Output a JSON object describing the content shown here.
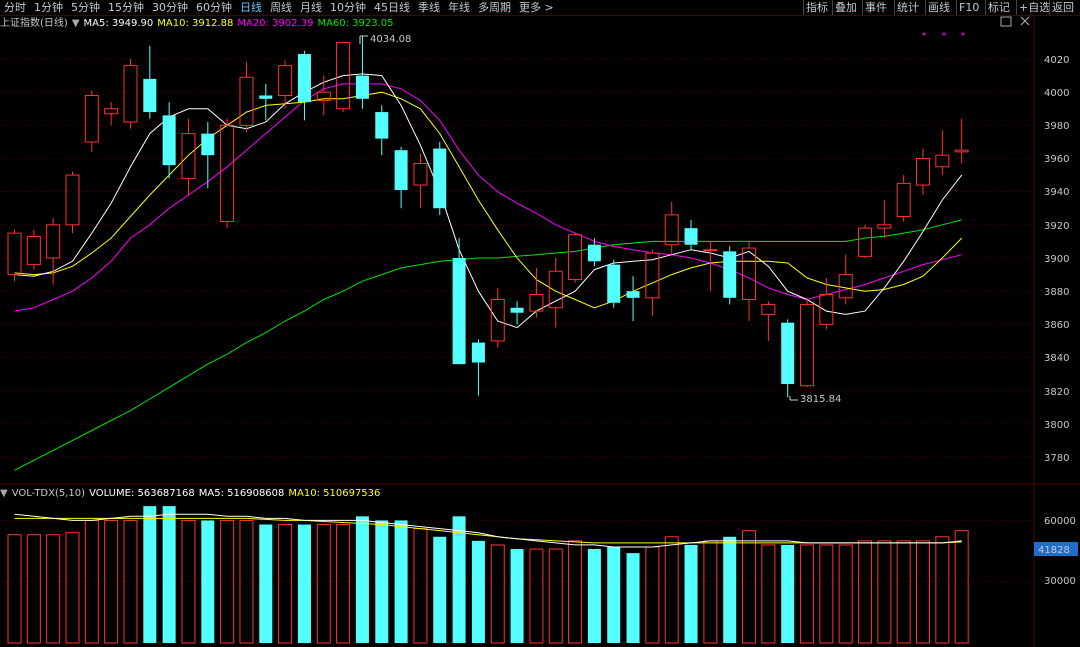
{
  "topbar": {
    "timeframes": [
      "分时",
      "1分钟",
      "5分钟",
      "15分钟",
      "30分钟",
      "60分钟",
      "日线",
      "周线",
      "月线",
      "10分钟",
      "45日线",
      "季线",
      "年线",
      "多周期",
      "更多 >"
    ],
    "active": "日线",
    "tools": [
      "指标",
      "叠加",
      "事件",
      "统计",
      "画线",
      "F10",
      "标记",
      "+自选",
      "返回"
    ]
  },
  "price_legend": {
    "name": "上证指数(日线)",
    "ma5": "MA5: 3949.90",
    "ma10": "MA10: 3912.88",
    "ma20": "MA20: 3902.39",
    "ma60": "MA60: 3923.05"
  },
  "vol_legend": {
    "name": "VOL-TDX(5,10)",
    "volume": "VOLUME: 563687168",
    "ma5": "MA5: 516908608",
    "ma10": "MA10: 510697536"
  },
  "annotations": {
    "high": "4034.08",
    "low": "3815.84"
  },
  "price_axis": {
    "ticks": [
      "4020",
      "4000",
      "3980",
      "3960",
      "3940",
      "3920",
      "3900",
      "3880",
      "3860",
      "3840",
      "3820",
      "3800",
      "3780"
    ]
  },
  "vol_axis": {
    "ticks": [
      "60000",
      "30000"
    ],
    "current": "41828"
  },
  "colors": {
    "up": "#ff3232",
    "down": "#54ffff",
    "ma5": "#ffffff",
    "ma10": "#ffff00",
    "ma20": "#ff00ff",
    "ma60": "#00e600",
    "grid": "#3c0000"
  },
  "chart_data": {
    "type": "candlestick",
    "ylim": [
      3770,
      4035
    ],
    "vol_ylim": [
      0,
      70000
    ],
    "candles": [
      {
        "o": 3890,
        "c": 3915,
        "h": 3917,
        "l": 3886,
        "v": 53000
      },
      {
        "o": 3896,
        "c": 3913,
        "h": 3917,
        "l": 3893,
        "v": 53000
      },
      {
        "o": 3900,
        "c": 3920,
        "h": 3924,
        "l": 3884,
        "v": 53000
      },
      {
        "o": 3920,
        "c": 3950,
        "h": 3952,
        "l": 3915,
        "v": 54000
      },
      {
        "o": 3970,
        "c": 3998,
        "h": 4001,
        "l": 3964,
        "v": 60000
      },
      {
        "o": 3987,
        "c": 3990,
        "h": 3994,
        "l": 3980,
        "v": 60000
      },
      {
        "o": 3982,
        "c": 4016,
        "h": 4020,
        "l": 3978,
        "v": 60000
      },
      {
        "o": 4008,
        "c": 3988,
        "h": 4028,
        "l": 3984,
        "v": 67000
      },
      {
        "o": 3986,
        "c": 3956,
        "h": 3994,
        "l": 3948,
        "v": 67000
      },
      {
        "o": 3948,
        "c": 3975,
        "h": 3984,
        "l": 3938,
        "v": 60000
      },
      {
        "o": 3975,
        "c": 3962,
        "h": 3982,
        "l": 3942,
        "v": 60000
      },
      {
        "o": 3922,
        "c": 3980,
        "h": 3984,
        "l": 3918,
        "v": 60000
      },
      {
        "o": 3980,
        "c": 4009,
        "h": 4018,
        "l": 3976,
        "v": 60000
      },
      {
        "o": 3998,
        "c": 3996,
        "h": 4005,
        "l": 3983,
        "v": 58000
      },
      {
        "o": 3998,
        "c": 4016,
        "h": 4019,
        "l": 3990,
        "v": 58000
      },
      {
        "o": 4023,
        "c": 3994,
        "h": 4025,
        "l": 3983,
        "v": 58000
      },
      {
        "o": 3995,
        "c": 4000,
        "h": 4010,
        "l": 3986,
        "v": 58000
      },
      {
        "o": 3990,
        "c": 4030,
        "h": 4030,
        "l": 3988,
        "v": 58000
      },
      {
        "o": 4010,
        "c": 3996,
        "h": 4034,
        "l": 3990,
        "v": 62000
      },
      {
        "o": 3988,
        "c": 3972,
        "h": 3992,
        "l": 3962,
        "v": 60000
      },
      {
        "o": 3965,
        "c": 3941,
        "h": 3967,
        "l": 3930,
        "v": 60000
      },
      {
        "o": 3944,
        "c": 3957,
        "h": 3963,
        "l": 3930,
        "v": 56000
      },
      {
        "o": 3966,
        "c": 3930,
        "h": 3970,
        "l": 3926,
        "v": 52000
      },
      {
        "o": 3900,
        "c": 3836,
        "h": 3912,
        "l": 3836,
        "v": 62000
      },
      {
        "o": 3849,
        "c": 3837,
        "h": 3851,
        "l": 3817,
        "v": 50000
      },
      {
        "o": 3850,
        "c": 3875,
        "h": 3882,
        "l": 3846,
        "v": 48000
      },
      {
        "o": 3870,
        "c": 3867,
        "h": 3874,
        "l": 3860,
        "v": 46000
      },
      {
        "o": 3868,
        "c": 3878,
        "h": 3894,
        "l": 3864,
        "v": 46000
      },
      {
        "o": 3870,
        "c": 3892,
        "h": 3900,
        "l": 3858,
        "v": 46000
      },
      {
        "o": 3887,
        "c": 3914,
        "h": 3915,
        "l": 3885,
        "v": 50000
      },
      {
        "o": 3908,
        "c": 3898,
        "h": 3912,
        "l": 3895,
        "v": 46000
      },
      {
        "o": 3896,
        "c": 3873,
        "h": 3899,
        "l": 3870,
        "v": 47000
      },
      {
        "o": 3880,
        "c": 3876,
        "h": 3889,
        "l": 3862,
        "v": 44000
      },
      {
        "o": 3876,
        "c": 3903,
        "h": 3905,
        "l": 3865,
        "v": 47000
      },
      {
        "o": 3908,
        "c": 3926,
        "h": 3934,
        "l": 3902,
        "v": 52000
      },
      {
        "o": 3918,
        "c": 3908,
        "h": 3923,
        "l": 3905,
        "v": 48000
      },
      {
        "o": 3905,
        "c": 3905,
        "h": 3910,
        "l": 3880,
        "v": 50000
      },
      {
        "o": 3904,
        "c": 3876,
        "h": 3907,
        "l": 3872,
        "v": 52000
      },
      {
        "o": 3875,
        "c": 3906,
        "h": 3910,
        "l": 3862,
        "v": 55000
      },
      {
        "o": 3866,
        "c": 3872,
        "h": 3874,
        "l": 3850,
        "v": 48000
      },
      {
        "o": 3861,
        "c": 3824,
        "h": 3863,
        "l": 3816,
        "v": 48000
      },
      {
        "o": 3823,
        "c": 3872,
        "h": 3876,
        "l": 3822,
        "v": 48000
      },
      {
        "o": 3860,
        "c": 3878,
        "h": 3888,
        "l": 3857,
        "v": 48000
      },
      {
        "o": 3876,
        "c": 3890,
        "h": 3902,
        "l": 3872,
        "v": 48000
      },
      {
        "o": 3901,
        "c": 3918,
        "h": 3920,
        "l": 3900,
        "v": 50000
      },
      {
        "o": 3918,
        "c": 3920,
        "h": 3935,
        "l": 3912,
        "v": 50000
      },
      {
        "o": 3925,
        "c": 3945,
        "h": 3950,
        "l": 3922,
        "v": 50000
      },
      {
        "o": 3944,
        "c": 3960,
        "h": 3966,
        "l": 3938,
        "v": 50000
      },
      {
        "o": 3955,
        "c": 3962,
        "h": 3977,
        "l": 3950,
        "v": 52000
      },
      {
        "o": 3964,
        "c": 3965,
        "h": 3984,
        "l": 3957,
        "v": 55000
      }
    ],
    "ma5_line": [
      3890,
      3889,
      3892,
      3898,
      3915,
      3933,
      3955,
      3975,
      3985,
      3990,
      3990,
      3980,
      3978,
      3982,
      3993,
      4000,
      4006,
      4010,
      4011,
      4010,
      3992,
      3968,
      3940,
      3905,
      3880,
      3862,
      3858,
      3868,
      3874,
      3880,
      3893,
      3897,
      3898,
      3899,
      3902,
      3905,
      3903,
      3900,
      3904,
      3895,
      3880,
      3875,
      3868,
      3866,
      3868,
      3882,
      3898,
      3916,
      3935,
      3950
    ],
    "ma10_line": [
      3891,
      3890,
      3891,
      3895,
      3903,
      3912,
      3925,
      3938,
      3950,
      3962,
      3972,
      3980,
      3988,
      3992,
      3993,
      3994,
      3996,
      3996,
      3998,
      4000,
      3996,
      3990,
      3975,
      3955,
      3935,
      3917,
      3900,
      3887,
      3880,
      3875,
      3870,
      3874,
      3880,
      3885,
      3890,
      3894,
      3897,
      3898,
      3898,
      3898,
      3897,
      3888,
      3884,
      3882,
      3880,
      3881,
      3884,
      3889,
      3900,
      3912
    ],
    "ma20_line": [
      3868,
      3870,
      3875,
      3880,
      3888,
      3898,
      3912,
      3920,
      3930,
      3938,
      3946,
      3955,
      3965,
      3975,
      3985,
      3995,
      4002,
      4005,
      4005,
      4005,
      4002,
      3995,
      3983,
      3965,
      3950,
      3940,
      3933,
      3927,
      3920,
      3915,
      3910,
      3907,
      3905,
      3903,
      3902,
      3900,
      3897,
      3893,
      3888,
      3882,
      3878,
      3875,
      3878,
      3881,
      3884,
      3888,
      3892,
      3896,
      3899,
      3902
    ],
    "ma60_line": [
      3772,
      3778,
      3784,
      3790,
      3796,
      3802,
      3808,
      3815,
      3822,
      3829,
      3836,
      3842,
      3849,
      3855,
      3862,
      3868,
      3875,
      3880,
      3886,
      3890,
      3894,
      3896,
      3898,
      3899,
      3900,
      3900,
      3901,
      3902,
      3903,
      3904,
      3906,
      3908,
      3909,
      3910,
      3910,
      3910,
      3910,
      3910,
      3910,
      3910,
      3910,
      3910,
      3910,
      3910,
      3912,
      3913,
      3915,
      3917,
      3920,
      3923
    ],
    "vol_ma5": [
      63000,
      62000,
      61000,
      60000,
      60000,
      61000,
      62000,
      62000,
      63000,
      63000,
      63000,
      62000,
      62000,
      61000,
      61000,
      60000,
      60000,
      60000,
      60000,
      59000,
      58000,
      57000,
      56000,
      55000,
      54000,
      52000,
      51000,
      50000,
      49000,
      48000,
      48000,
      47000,
      47000,
      47000,
      48000,
      49000,
      50000,
      50000,
      50000,
      50000,
      50000,
      49000,
      49000,
      49000,
      49000,
      49000,
      49000,
      49000,
      49000,
      50000
    ],
    "vol_ma10": [
      61000,
      61000,
      61000,
      61000,
      61000,
      61000,
      61000,
      61000,
      61000,
      61000,
      61000,
      61000,
      61000,
      60500,
      60000,
      60000,
      59500,
      59000,
      58500,
      58000,
      57000,
      56000,
      55000,
      54000,
      53000,
      52000,
      51000,
      50500,
      50000,
      49500,
      49000,
      49000,
      49000,
      49000,
      49000,
      49000,
      49000,
      49000,
      49000,
      49000,
      49000,
      49000,
      49000,
      49000,
      49000,
      49000,
      49000,
      49000,
      49000,
      49500
    ]
  }
}
